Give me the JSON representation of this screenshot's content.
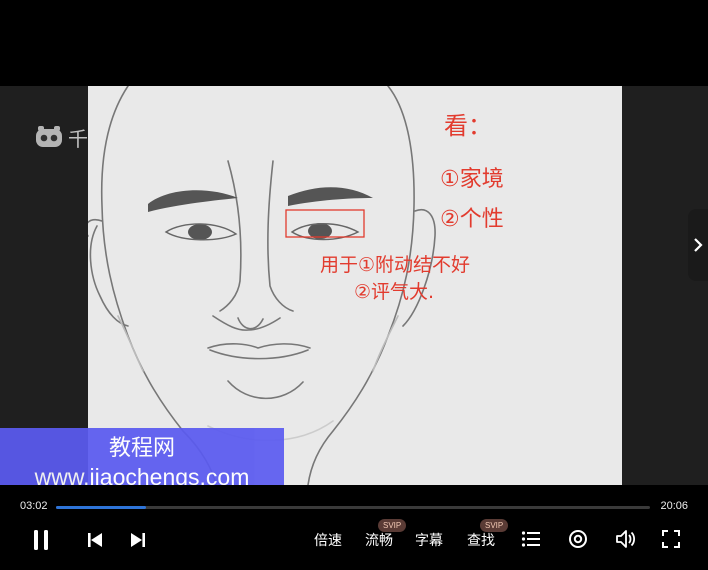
{
  "video": {
    "logo_text": "千",
    "annotations": {
      "heading": "看：",
      "item1": "①家境",
      "item2": "②个性",
      "line3": "用于①附动结不好",
      "line4": "②评气大."
    }
  },
  "watermark": {
    "line1": "教程网",
    "line2": "www.jiaochengs.com"
  },
  "player": {
    "current_time": "03:02",
    "duration": "20:06",
    "progress": 0.151,
    "speed_label": "倍速",
    "quality_label": "流畅",
    "quality_badge": "SVIP",
    "subtitle_label": "字幕",
    "search_label": "查找",
    "search_badge": "SVIP"
  },
  "colors": {
    "accent": "#2e74d8",
    "annotation_red": "#e23b2e",
    "watermark_bg": "#5b5bf0",
    "badge_bg": "#5a3b35"
  }
}
